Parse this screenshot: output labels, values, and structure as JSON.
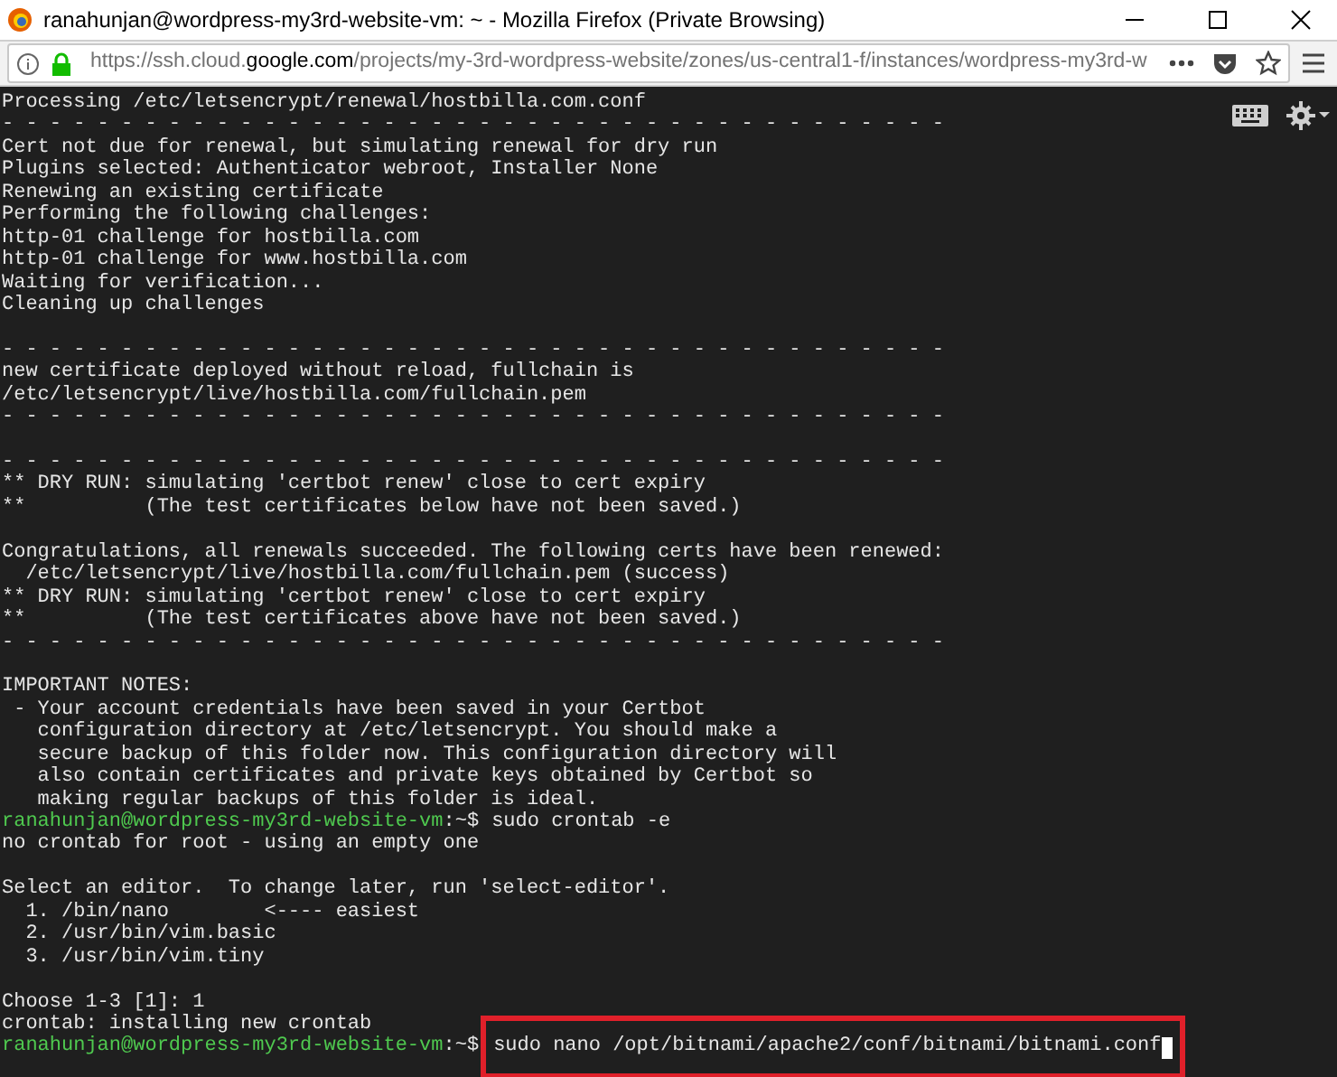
{
  "window": {
    "title": "ranahunjan@wordpress-my3rd-website-vm: ~ - Mozilla Firefox (Private Browsing)"
  },
  "address_bar": {
    "url": "https://ssh.cloud.**google.com**/projects/my-3rd-wordpress-website/zones/us-central1-f/instances/wordpress-my3rd-w"
  },
  "terminal": {
    "lines": [
      {
        "kind": "output",
        "text": "Processing /etc/letsencrypt/renewal/hostbilla.com.conf"
      },
      {
        "kind": "output",
        "text": "- - - - - - - - - - - - - - - - - - - - - - - - - - - - - - - - - - - - - - - -"
      },
      {
        "kind": "output",
        "text": "Cert not due for renewal, but simulating renewal for dry run"
      },
      {
        "kind": "output",
        "text": "Plugins selected: Authenticator webroot, Installer None"
      },
      {
        "kind": "output",
        "text": "Renewing an existing certificate"
      },
      {
        "kind": "output",
        "text": "Performing the following challenges:"
      },
      {
        "kind": "output",
        "text": "http-01 challenge for hostbilla.com"
      },
      {
        "kind": "output",
        "text": "http-01 challenge for www.hostbilla.com"
      },
      {
        "kind": "output",
        "text": "Waiting for verification..."
      },
      {
        "kind": "output",
        "text": "Cleaning up challenges"
      },
      {
        "kind": "blank"
      },
      {
        "kind": "output",
        "text": "- - - - - - - - - - - - - - - - - - - - - - - - - - - - - - - - - - - - - - - -"
      },
      {
        "kind": "output",
        "text": "new certificate deployed without reload, fullchain is"
      },
      {
        "kind": "output",
        "text": "/etc/letsencrypt/live/hostbilla.com/fullchain.pem"
      },
      {
        "kind": "output",
        "text": "- - - - - - - - - - - - - - - - - - - - - - - - - - - - - - - - - - - - - - - -"
      },
      {
        "kind": "blank"
      },
      {
        "kind": "output",
        "text": "- - - - - - - - - - - - - - - - - - - - - - - - - - - - - - - - - - - - - - - -"
      },
      {
        "kind": "output",
        "text": "** DRY RUN: simulating 'certbot renew' close to cert expiry"
      },
      {
        "kind": "output",
        "text": "**          (The test certificates below have not been saved.)"
      },
      {
        "kind": "blank"
      },
      {
        "kind": "output",
        "text": "Congratulations, all renewals succeeded. The following certs have been renewed:"
      },
      {
        "kind": "output",
        "text": "  /etc/letsencrypt/live/hostbilla.com/fullchain.pem (success)"
      },
      {
        "kind": "output",
        "text": "** DRY RUN: simulating 'certbot renew' close to cert expiry"
      },
      {
        "kind": "output",
        "text": "**          (The test certificates above have not been saved.)"
      },
      {
        "kind": "output",
        "text": "- - - - - - - - - - - - - - - - - - - - - - - - - - - - - - - - - - - - - - - -"
      },
      {
        "kind": "blank"
      },
      {
        "kind": "output",
        "text": "IMPORTANT NOTES:"
      },
      {
        "kind": "output",
        "text": " - Your account credentials have been saved in your Certbot"
      },
      {
        "kind": "output",
        "text": "   configuration directory at /etc/letsencrypt. You should make a"
      },
      {
        "kind": "output",
        "text": "   secure backup of this folder now. This configuration directory will"
      },
      {
        "kind": "output",
        "text": "   also contain certificates and private keys obtained by Certbot so"
      },
      {
        "kind": "output",
        "text": "   making regular backups of this folder is ideal."
      },
      {
        "kind": "prompt",
        "user": "ranahunjan@wordpress-my3rd-website-vm",
        "path": ":~$",
        "command": "sudo crontab -e",
        "highlighted": false,
        "cursor": false
      },
      {
        "kind": "output",
        "text": "no crontab for root - using an empty one"
      },
      {
        "kind": "blank"
      },
      {
        "kind": "output",
        "text": "Select an editor.  To change later, run 'select-editor'."
      },
      {
        "kind": "output",
        "text": "  1. /bin/nano        <---- easiest"
      },
      {
        "kind": "output",
        "text": "  2. /usr/bin/vim.basic"
      },
      {
        "kind": "output",
        "text": "  3. /usr/bin/vim.tiny"
      },
      {
        "kind": "blank"
      },
      {
        "kind": "output",
        "text": "Choose 1-3 [1]: 1"
      },
      {
        "kind": "output",
        "text": "crontab: installing new crontab"
      },
      {
        "kind": "prompt",
        "user": "ranahunjan@wordpress-my3rd-website-vm",
        "path": ":~$",
        "command": "sudo nano /opt/bitnami/apache2/conf/bitnami/bitnami.conf",
        "highlighted": true,
        "cursor": true
      }
    ]
  }
}
